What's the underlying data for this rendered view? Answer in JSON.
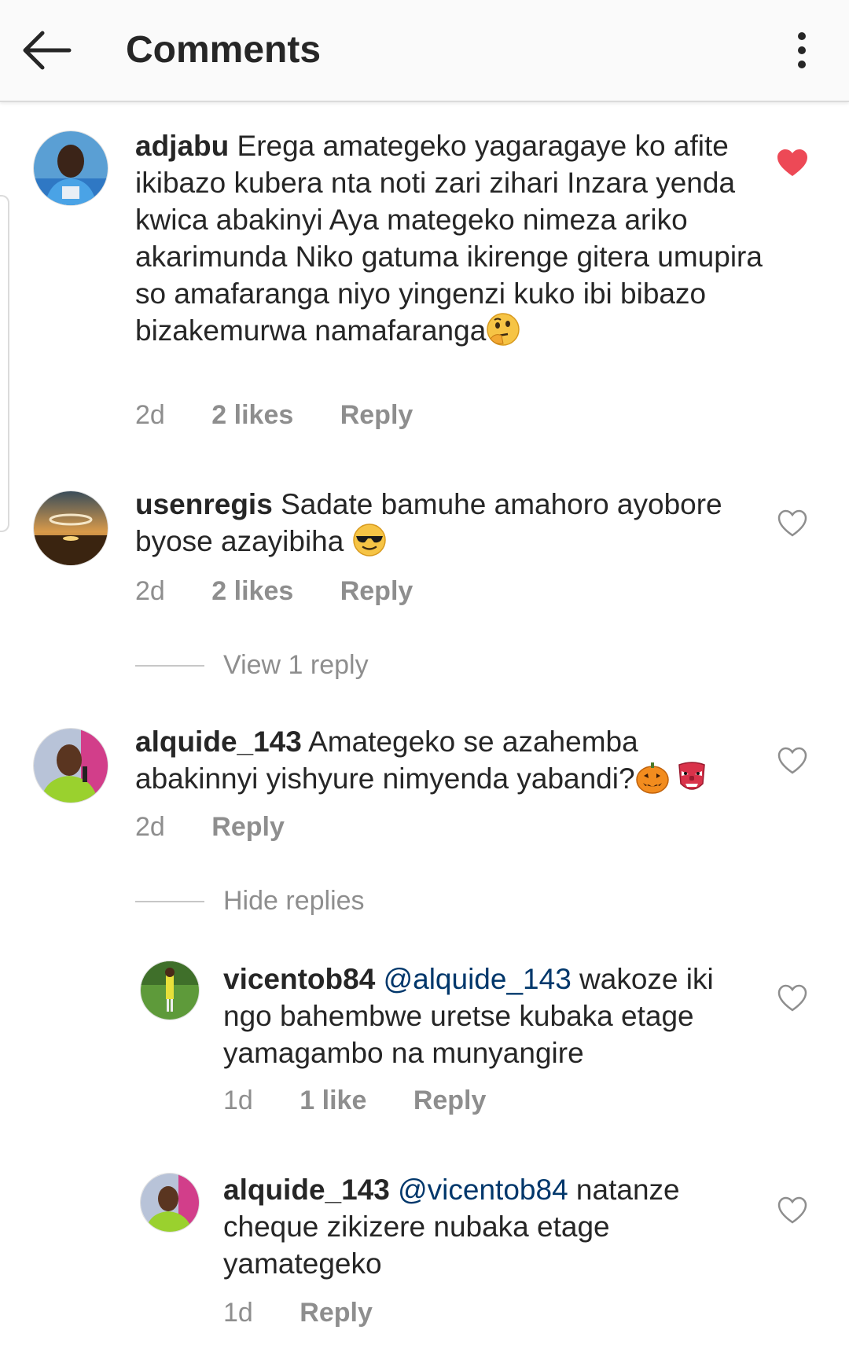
{
  "header": {
    "title": "Comments",
    "back_icon": "arrow-left-icon",
    "more_icon": "more-vertical-icon"
  },
  "colors": {
    "liked_heart": "#ed4956",
    "meta_gray": "#8e8e8e",
    "mention": "#00376b"
  },
  "comments": [
    {
      "username": "adjabu",
      "text": "Erega  amategeko yagaragaye ko afite ikibazo kubera nta noti zari zihari  Inzara yenda kwica abakinyi Aya mategeko nimeza ariko akarimunda Niko gatuma ikirenge gitera umupira  so amafaranga niyo yingenzi kuko ibi bibazo bizakemurwa namafaranga",
      "emoji": "thinking-face",
      "time": "2d",
      "likes": "2 likes",
      "reply": "Reply",
      "liked": true
    },
    {
      "username": "usenregis",
      "text": "Sadate bamuhe amahoro ayobore byose azayibiha ",
      "emoji": "sunglasses-face",
      "time": "2d",
      "likes": "2 likes",
      "reply": "Reply",
      "liked": false,
      "view_replies": "View 1 reply"
    },
    {
      "username": "alquide_143",
      "text": "Amategeko se azahemba abakinnyi yishyure nimyenda yabandi?",
      "emoji": "jack-o-lantern, goblin-mask",
      "time": "2d",
      "reply": "Reply",
      "liked": false,
      "hide_replies": "Hide replies",
      "replies": [
        {
          "username": "vicentob84",
          "mention": "@alquide_143",
          "text": " wakoze iki ngo bahembwe uretse kubaka etage yamagambo na munyangire",
          "time": "1d",
          "likes": "1 like",
          "reply": "Reply",
          "liked": false
        },
        {
          "username": "alquide_143",
          "mention": "@vicentob84",
          "text": " natanze cheque zikizere nubaka etage yamategeko",
          "time": "1d",
          "reply": "Reply",
          "liked": false
        }
      ]
    }
  ]
}
